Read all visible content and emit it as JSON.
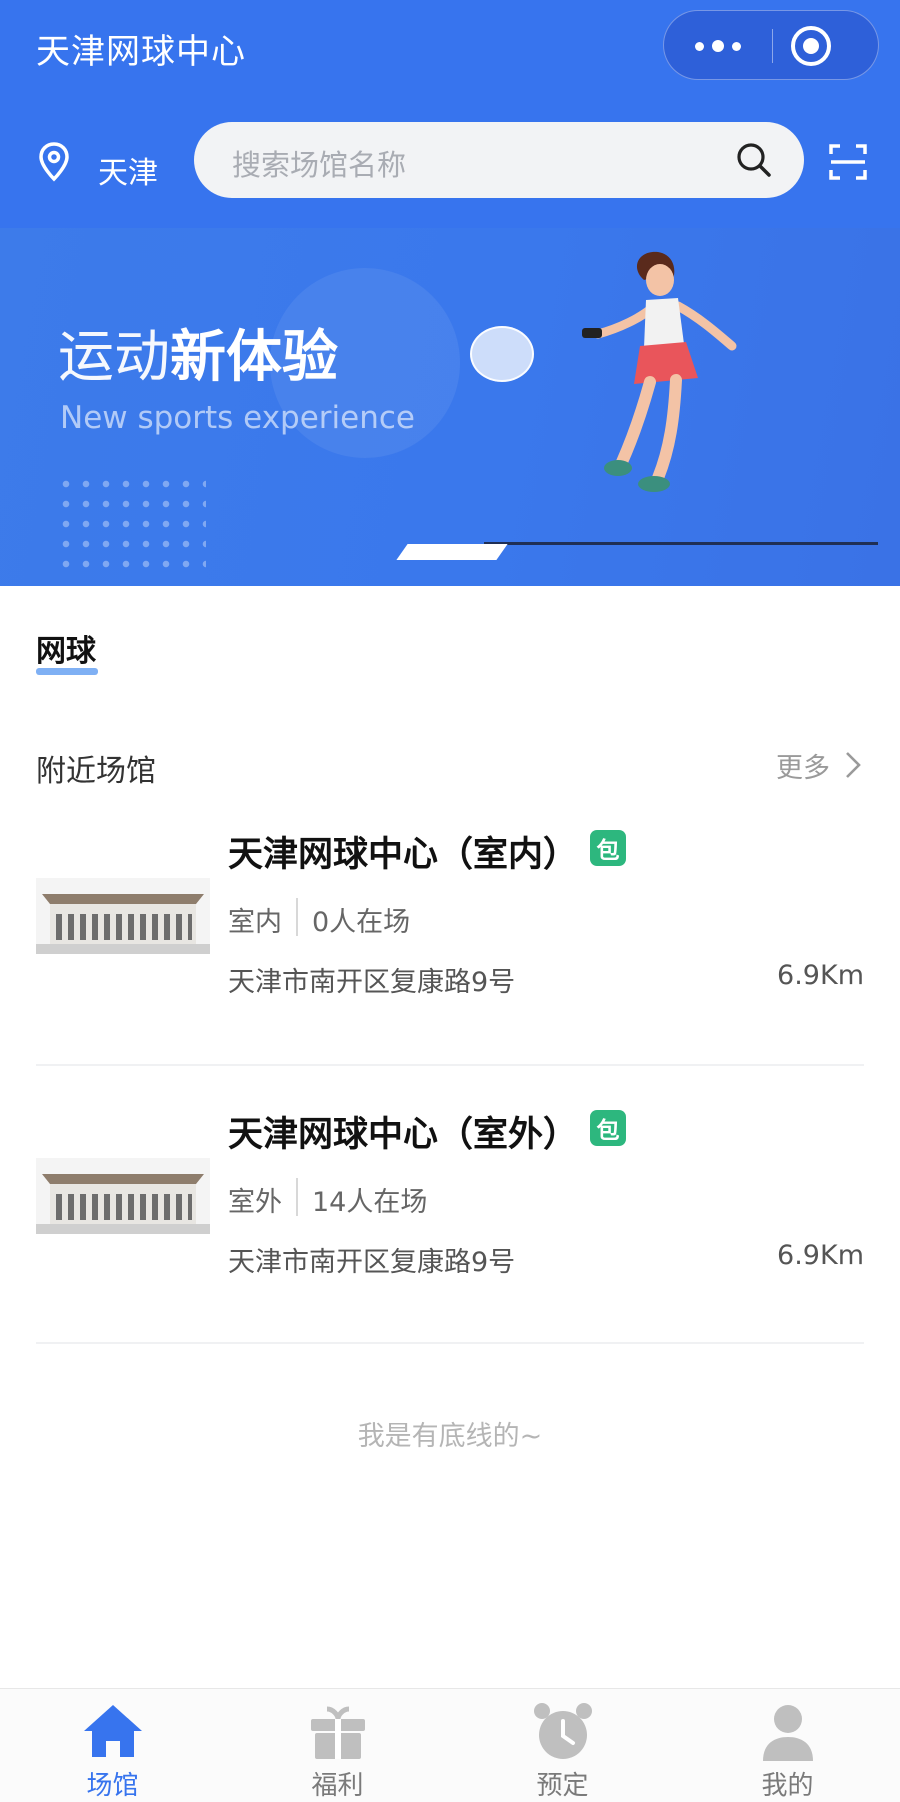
{
  "header": {
    "app_title": "天津网球中心",
    "city": "天津",
    "search_placeholder": "搜索场馆名称"
  },
  "banner": {
    "title_part1": "运动",
    "title_part2": "新体验",
    "subtitle": "New sports experience"
  },
  "tabs": [
    {
      "label": "网球",
      "active": true
    }
  ],
  "nearby": {
    "title": "附近场馆",
    "more_label": "更多"
  },
  "venues": [
    {
      "name": "天津网球中心（室内）",
      "badge": "包",
      "type": "室内",
      "people": "0人在场",
      "address": "天津市南开区复康路9号",
      "distance": "6.9Km"
    },
    {
      "name": "天津网球中心（室外）",
      "badge": "包",
      "type": "室外",
      "people": "14人在场",
      "address": "天津市南开区复康路9号",
      "distance": "6.9Km"
    }
  ],
  "footer_note": "我是有底线的~",
  "tabbar": [
    {
      "label": "场馆",
      "icon": "home-icon",
      "active": true
    },
    {
      "label": "福利",
      "icon": "gift-icon",
      "active": false
    },
    {
      "label": "预定",
      "icon": "alarm-clock-icon",
      "active": false
    },
    {
      "label": "我的",
      "icon": "user-icon",
      "active": false
    }
  ],
  "colors": {
    "primary": "#3774ee",
    "badge": "#2db77e",
    "tab_underline": "#7fb0f4",
    "inactive_tab": "#bfbfbf"
  }
}
